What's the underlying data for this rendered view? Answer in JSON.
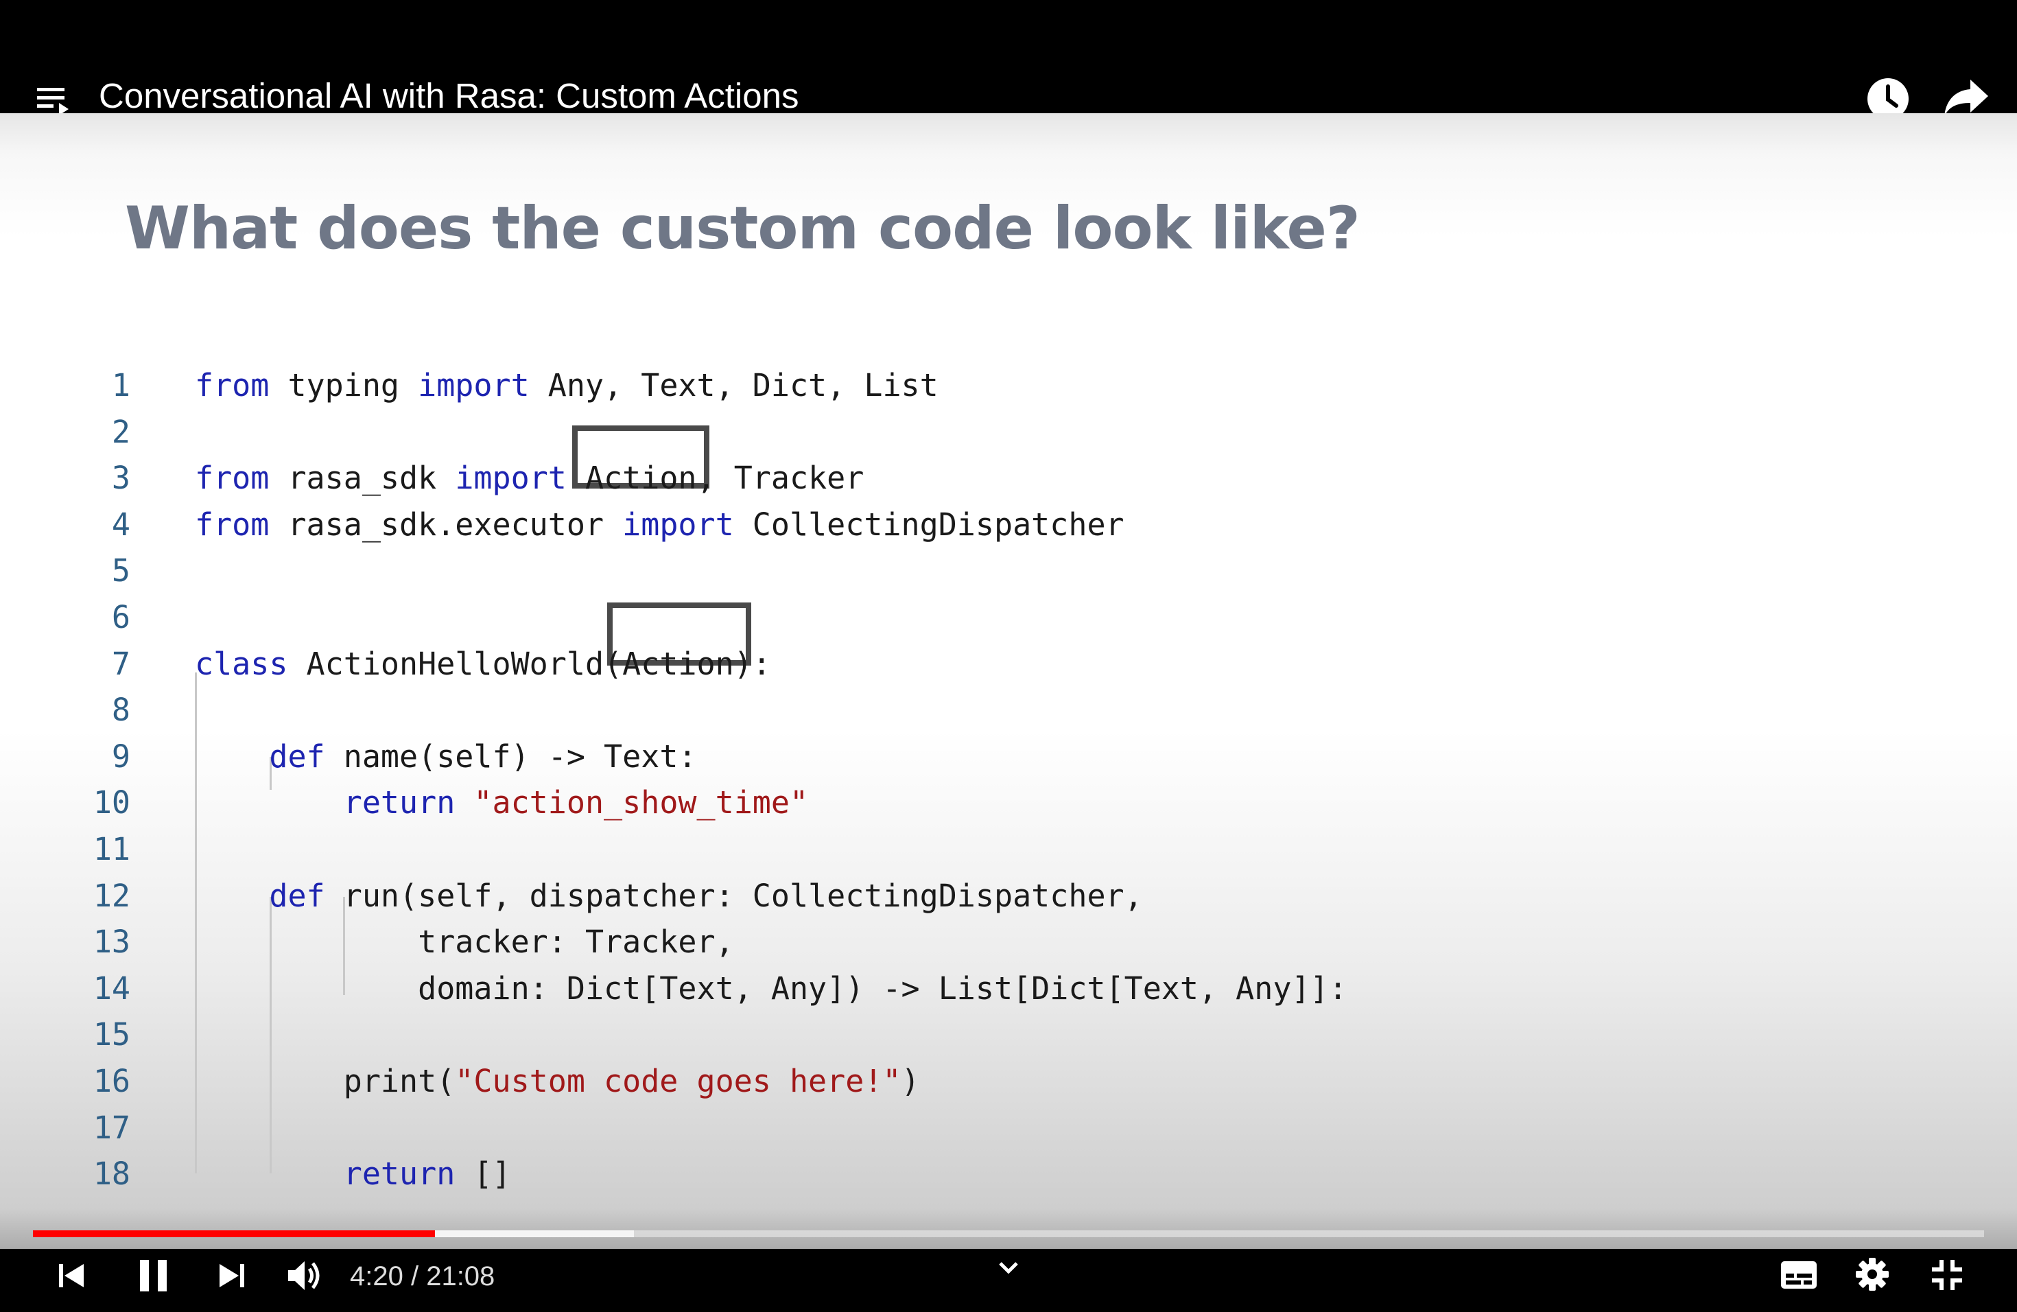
{
  "video": {
    "title": "Conversational AI with Rasa: Custom Actions",
    "current_time": "4:20",
    "separator": " / ",
    "duration": "21:08",
    "progress_played": 0.206,
    "progress_buffered": 0.308
  },
  "icons": {
    "playlist": "playlist-icon",
    "watch_later": "clock-icon",
    "share": "share-arrow-icon",
    "previous": "skip-previous-icon",
    "pause": "pause-icon",
    "next": "skip-next-icon",
    "volume": "volume-icon",
    "chevron": "chevron-down-icon",
    "subtitles": "subtitles-icon",
    "settings": "gear-icon",
    "exit_fullscreen": "exit-fullscreen-icon"
  },
  "colors": {
    "progress": "#ff0000",
    "keyword": "#1d24b0",
    "string": "#a0191a",
    "line_number": "#2f5f86",
    "slide_title": "#6f7787"
  },
  "slide": {
    "title": "What does the custom code look like?",
    "lines": [
      {
        "n": "1",
        "segs": [
          [
            "kw",
            "from"
          ],
          [
            "t",
            " typing "
          ],
          [
            "kw",
            "import"
          ],
          [
            "t",
            " Any, Text, Dict, List"
          ]
        ]
      },
      {
        "n": "2",
        "segs": []
      },
      {
        "n": "3",
        "segs": [
          [
            "kw",
            "from"
          ],
          [
            "t",
            " rasa_sdk "
          ],
          [
            "kw",
            "import"
          ],
          [
            "t",
            " Action, Tracker"
          ]
        ]
      },
      {
        "n": "4",
        "segs": [
          [
            "kw",
            "from"
          ],
          [
            "t",
            " rasa_sdk.executor "
          ],
          [
            "kw",
            "import"
          ],
          [
            "t",
            " CollectingDispatcher"
          ]
        ]
      },
      {
        "n": "5",
        "segs": []
      },
      {
        "n": "6",
        "segs": []
      },
      {
        "n": "7",
        "segs": [
          [
            "kw",
            "class"
          ],
          [
            "t",
            " ActionHelloWorld(Action):"
          ]
        ]
      },
      {
        "n": "8",
        "segs": []
      },
      {
        "n": "9",
        "segs": [
          [
            "t",
            "    "
          ],
          [
            "kw",
            "def"
          ],
          [
            "t",
            " name(self) -> Text:"
          ]
        ]
      },
      {
        "n": "10",
        "segs": [
          [
            "t",
            "        "
          ],
          [
            "kw",
            "return"
          ],
          [
            "t",
            " "
          ],
          [
            "str",
            "\"action_show_time\""
          ]
        ]
      },
      {
        "n": "11",
        "segs": []
      },
      {
        "n": "12",
        "segs": [
          [
            "t",
            "    "
          ],
          [
            "kw",
            "def"
          ],
          [
            "t",
            " run(self, dispatcher: CollectingDispatcher,"
          ]
        ]
      },
      {
        "n": "13",
        "segs": [
          [
            "t",
            "            tracker: Tracker,"
          ]
        ]
      },
      {
        "n": "14",
        "segs": [
          [
            "t",
            "            domain: Dict[Text, Any]) -> List[Dict[Text, Any]]:"
          ]
        ]
      },
      {
        "n": "15",
        "segs": []
      },
      {
        "n": "16",
        "segs": [
          [
            "t",
            "        print("
          ],
          [
            "str",
            "\"Custom code goes here!\""
          ],
          [
            "t",
            ")"
          ]
        ]
      },
      {
        "n": "17",
        "segs": []
      },
      {
        "n": "18",
        "segs": [
          [
            "t",
            "        "
          ],
          [
            "kw",
            "return"
          ],
          [
            "t",
            " []"
          ]
        ]
      }
    ]
  }
}
